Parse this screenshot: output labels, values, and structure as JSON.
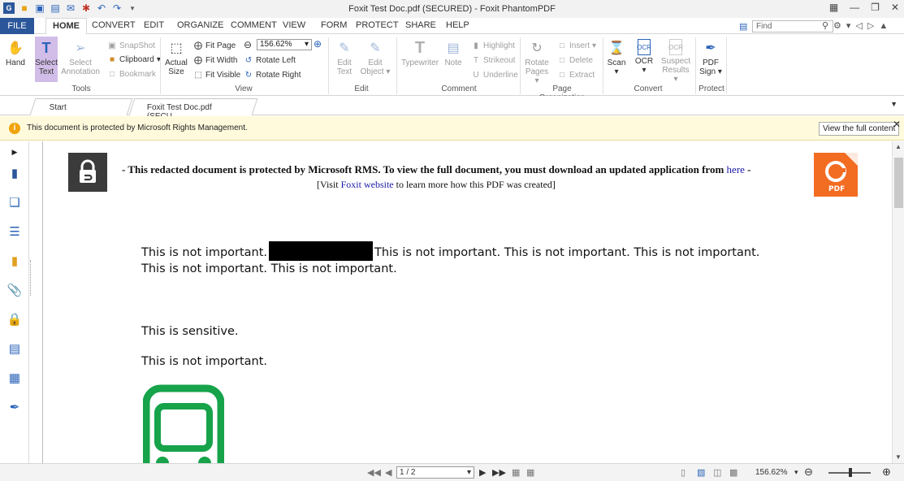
{
  "window": {
    "title": "Foxit Test Doc.pdf (SECURED) - Foxit PhantomPDF"
  },
  "ribbon_tabs": [
    "FILE",
    "HOME",
    "CONVERT",
    "EDIT",
    "ORGANIZE",
    "COMMENT",
    "VIEW",
    "FORM",
    "PROTECT",
    "SHARE",
    "HELP"
  ],
  "find": {
    "placeholder": "Find"
  },
  "tools": {
    "hand": "Hand",
    "select_text_1": "Select",
    "select_text_2": "Text",
    "select_annot_1": "Select",
    "select_annot_2": "Annotation",
    "snapshot": "SnapShot",
    "clipboard": "Clipboard",
    "bookmark": "Bookmark",
    "group": "Tools"
  },
  "view_group": {
    "actual_size_1": "Actual",
    "actual_size_2": "Size",
    "fit_page": "Fit Page",
    "fit_width": "Fit Width",
    "fit_visible": "Fit Visible",
    "zoom": "156.62%",
    "rotate_left": "Rotate Left",
    "rotate_right": "Rotate Right",
    "group": "View"
  },
  "edit_group": {
    "edit_text_1": "Edit",
    "edit_text_2": "Text",
    "edit_object_1": "Edit",
    "edit_object_2": "Object",
    "group": "Edit"
  },
  "comment_group": {
    "typewriter": "Typewriter",
    "note": "Note",
    "highlight": "Highlight",
    "strikeout": "Strikeout",
    "underline": "Underline",
    "group": "Comment"
  },
  "page_org_group": {
    "rotate_pages_1": "Rotate",
    "rotate_pages_2": "Pages",
    "insert": "Insert",
    "delete": "Delete",
    "extract": "Extract",
    "group": "Page Organization"
  },
  "convert_group": {
    "scan": "Scan",
    "ocr": "OCR",
    "suspect_1": "Suspect",
    "suspect_2": "Results",
    "group": "Convert"
  },
  "protect_group": {
    "pdf_sign_1": "PDF",
    "pdf_sign_2": "Sign",
    "group": "Protect"
  },
  "doc_tabs": {
    "start": "Start",
    "doc": "Foxit Test Doc.pdf (SECU..."
  },
  "notice": {
    "message": "This document is protected by Microsoft Rights Management.",
    "button": "View the full content"
  },
  "document": {
    "headline_prefix": "- This redacted document is protected by Microsoft RMS. To view the full document, you must download an updated application from",
    "headline_link": "here",
    "headline_suffix": "-",
    "sub_prefix": "[Visit",
    "sub_link": "Foxit website",
    "sub_suffix": "to learn more how this PDF was created]",
    "logo_text": "PDF",
    "para1_a": "This is not important.",
    "para1_b": "This is not important. This is not important. This is not important.",
    "para1_c": "This is not important. This is not important.",
    "para2": "This is sensitive.",
    "para3": "This is not important."
  },
  "statusbar": {
    "page": "1 / 2",
    "zoom": "156.62%"
  },
  "colors": {
    "file_tab": "#2b579a",
    "accent_select": "#d2bde8",
    "notice_bg": "#fffadc",
    "foxit_orange": "#f26c22",
    "link_blue": "#1a1aa6",
    "bus_green": "#16a34a"
  },
  "icons": [
    "app-logo-icon",
    "open-icon",
    "save-icon",
    "print-icon",
    "undo-icon",
    "redo-icon",
    "hand-icon",
    "select-text-icon",
    "lock-icon",
    "foxit-pdf-logo",
    "bus-icon",
    "info-icon"
  ]
}
